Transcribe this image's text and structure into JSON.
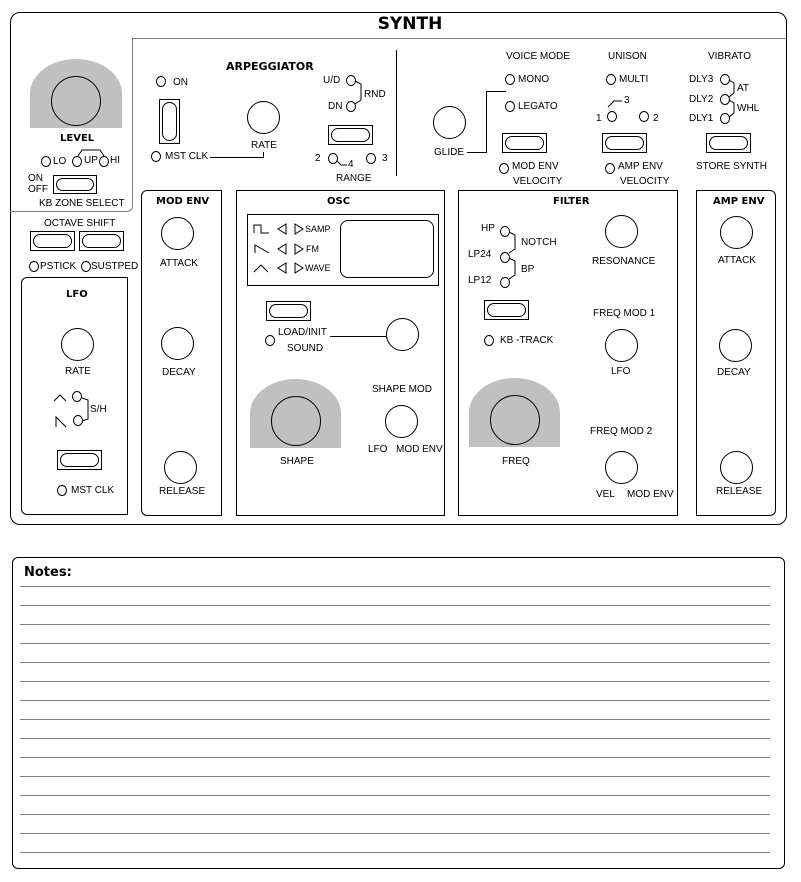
{
  "title": "SYNTH",
  "level": {
    "label": "LEVEL",
    "leds": [
      "LO",
      "UP",
      "HI"
    ],
    "onoff": [
      "ON",
      "OFF"
    ],
    "zone_label": "KB ZONE SELECT"
  },
  "octave": {
    "label": "OCTAVE SHIFT",
    "leds": [
      "PSTICK",
      "SUSTPED"
    ]
  },
  "arp": {
    "title": "ARPEGGIATOR",
    "on": "ON",
    "mst_clk": "MST CLK",
    "rate": "RATE",
    "ud": "U/D",
    "dn": "DN",
    "rnd": "RND",
    "range": "RANGE",
    "r2": "2",
    "r4": "4",
    "r3": "3"
  },
  "glide": "GLIDE",
  "voice_mode": {
    "title": "VOICE MODE",
    "mono": "MONO",
    "legato": "LEGATO",
    "vel1": "MOD ENV",
    "vel2": "VELOCITY"
  },
  "unison": {
    "title": "UNISON",
    "multi": "MULTI",
    "n1": "1",
    "n2": "2",
    "n3": "3",
    "vel1": "AMP ENV",
    "vel2": "VELOCITY"
  },
  "vibrato": {
    "title": "VIBRATO",
    "dly3": "DLY3",
    "dly2": "DLY2",
    "dly1": "DLY1",
    "at": "AT",
    "whl": "WHL",
    "store": "STORE SYNTH"
  },
  "lfo": {
    "title": "LFO",
    "rate": "RATE",
    "sh": "S/H",
    "mst_clk": "MST CLK"
  },
  "mod_env": {
    "title": "MOD ENV",
    "attack": "ATTACK",
    "decay": "DECAY",
    "release": "RELEASE"
  },
  "osc": {
    "title": "OSC",
    "samp": "SAMP",
    "fm": "FM",
    "wave": "WAVE",
    "load1": "LOAD/INIT",
    "load2": "SOUND",
    "shape": "SHAPE",
    "shape_mod": "SHAPE MOD",
    "lfo": "LFO",
    "mod_env": "MOD ENV"
  },
  "filter": {
    "title": "FILTER",
    "hp": "HP",
    "lp24": "LP24",
    "lp12": "LP12",
    "notch": "NOTCH",
    "bp": "BP",
    "kb_track": "KB -TRACK",
    "resonance": "RESONANCE",
    "freq_mod1": "FREQ MOD 1",
    "lfo": "LFO",
    "freq": "FREQ",
    "freq_mod2": "FREQ MOD 2",
    "vel": "VEL",
    "mod_env": "MOD ENV"
  },
  "amp_env": {
    "title": "AMP ENV",
    "attack": "ATTACK",
    "decay": "DECAY",
    "release": "RELEASE"
  },
  "notes": {
    "label": "Notes:",
    "line_count": 15
  }
}
